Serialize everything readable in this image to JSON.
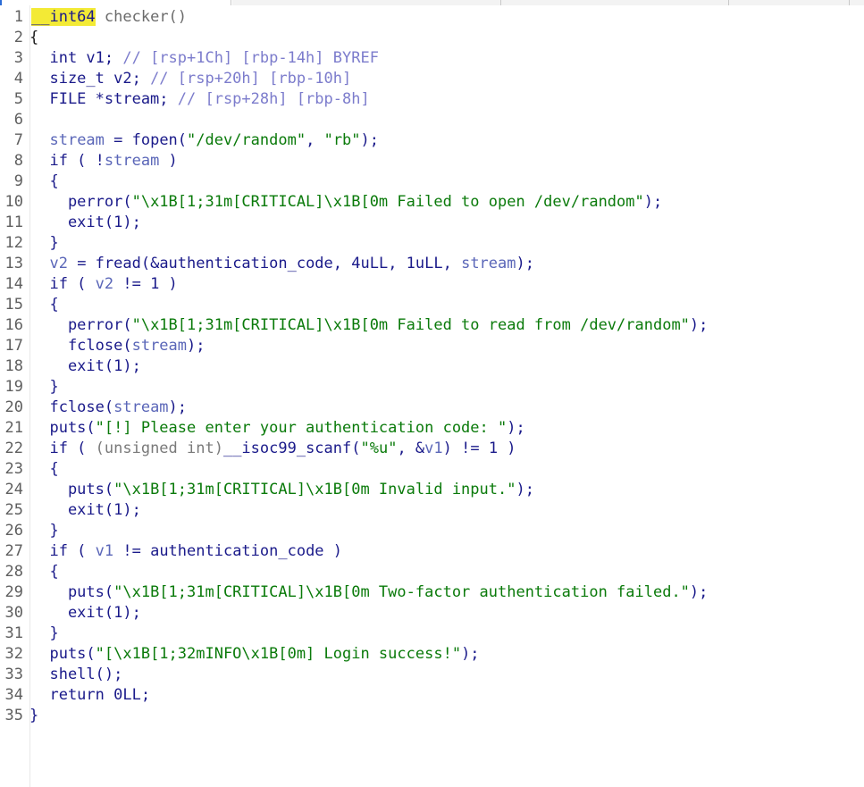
{
  "editor": {
    "lines": [
      {
        "n": "1",
        "tokens": [
          {
            "t": "__int64",
            "cls": "hl"
          },
          {
            "t": " "
          },
          {
            "t": "checker()",
            "cls": "fn"
          }
        ]
      },
      {
        "n": "2",
        "tokens": [
          {
            "t": "{",
            "x": -1
          }
        ]
      },
      {
        "n": "3",
        "tokens": [
          {
            "t": "  int v1; ",
            "cls": "k"
          },
          {
            "t": "// [rsp+1Ch] [rbp-14h] BYREF",
            "cls": "c"
          }
        ]
      },
      {
        "n": "4",
        "tokens": [
          {
            "t": "  size_t v2; ",
            "cls": "k"
          },
          {
            "t": "// [rsp+20h] [rbp-10h]",
            "cls": "c"
          }
        ]
      },
      {
        "n": "5",
        "tokens": [
          {
            "t": "  FILE *stream; ",
            "cls": "k"
          },
          {
            "t": "// [rsp+28h] [rbp-8h]",
            "cls": "c"
          }
        ]
      },
      {
        "n": "6",
        "tokens": []
      },
      {
        "n": "7",
        "tokens": [
          {
            "t": "  "
          },
          {
            "t": "stream",
            "cls": "v"
          },
          {
            "t": " = fopen(",
            "cls": "k"
          },
          {
            "t": "\"/dev/random\"",
            "cls": "s"
          },
          {
            "t": ", ",
            "cls": "k"
          },
          {
            "t": "\"rb\"",
            "cls": "s"
          },
          {
            "t": ");",
            "cls": "k"
          }
        ]
      },
      {
        "n": "8",
        "tokens": [
          {
            "t": "  if ( !",
            "cls": "k"
          },
          {
            "t": "stream",
            "cls": "v"
          },
          {
            "t": " )",
            "cls": "k"
          }
        ]
      },
      {
        "n": "9",
        "tokens": [
          {
            "t": "  {",
            "cls": "k"
          }
        ]
      },
      {
        "n": "10",
        "tokens": [
          {
            "t": "    perror(",
            "cls": "k"
          },
          {
            "t": "\"\\x1B[1;31m[CRITICAL]\\x1B[0m Failed to open /dev/random\"",
            "cls": "s"
          },
          {
            "t": ");",
            "cls": "k"
          }
        ]
      },
      {
        "n": "11",
        "tokens": [
          {
            "t": "    exit(1);",
            "cls": "k"
          }
        ]
      },
      {
        "n": "12",
        "tokens": [
          {
            "t": "  }",
            "cls": "k"
          }
        ]
      },
      {
        "n": "13",
        "tokens": [
          {
            "t": "  "
          },
          {
            "t": "v2",
            "cls": "v"
          },
          {
            "t": " = fread(&authentication_code, 4uLL, 1uLL, ",
            "cls": "k"
          },
          {
            "t": "stream",
            "cls": "v"
          },
          {
            "t": ");",
            "cls": "k"
          }
        ]
      },
      {
        "n": "14",
        "tokens": [
          {
            "t": "  if ( ",
            "cls": "k"
          },
          {
            "t": "v2",
            "cls": "v"
          },
          {
            "t": " != 1 )",
            "cls": "k"
          }
        ]
      },
      {
        "n": "15",
        "tokens": [
          {
            "t": "  {",
            "cls": "k"
          }
        ]
      },
      {
        "n": "16",
        "tokens": [
          {
            "t": "    perror(",
            "cls": "k"
          },
          {
            "t": "\"\\x1B[1;31m[CRITICAL]\\x1B[0m Failed to read from /dev/random\"",
            "cls": "s"
          },
          {
            "t": ");",
            "cls": "k"
          }
        ]
      },
      {
        "n": "17",
        "tokens": [
          {
            "t": "    fclose(",
            "cls": "k"
          },
          {
            "t": "stream",
            "cls": "v"
          },
          {
            "t": ");",
            "cls": "k"
          }
        ]
      },
      {
        "n": "18",
        "tokens": [
          {
            "t": "    exit(1);",
            "cls": "k"
          }
        ]
      },
      {
        "n": "19",
        "tokens": [
          {
            "t": "  }",
            "cls": "k"
          }
        ]
      },
      {
        "n": "20",
        "tokens": [
          {
            "t": "  fclose(",
            "cls": "k"
          },
          {
            "t": "stream",
            "cls": "v"
          },
          {
            "t": ");",
            "cls": "k"
          }
        ]
      },
      {
        "n": "21",
        "tokens": [
          {
            "t": "  puts(",
            "cls": "k"
          },
          {
            "t": "\"[!] Please enter your authentication code: \"",
            "cls": "s"
          },
          {
            "t": ");",
            "cls": "k"
          }
        ]
      },
      {
        "n": "22",
        "tokens": [
          {
            "t": "  if ( ",
            "cls": "k"
          },
          {
            "t": "(unsigned int)",
            "cls": "g"
          },
          {
            "t": "__isoc99_scanf(",
            "cls": "k"
          },
          {
            "t": "\"%u\"",
            "cls": "s"
          },
          {
            "t": ", &",
            "cls": "k"
          },
          {
            "t": "v1",
            "cls": "v"
          },
          {
            "t": ") != 1 )",
            "cls": "k"
          }
        ]
      },
      {
        "n": "23",
        "tokens": [
          {
            "t": "  {",
            "cls": "k"
          }
        ]
      },
      {
        "n": "24",
        "tokens": [
          {
            "t": "    puts(",
            "cls": "k"
          },
          {
            "t": "\"\\x1B[1;31m[CRITICAL]\\x1B[0m Invalid input.\"",
            "cls": "s"
          },
          {
            "t": ");",
            "cls": "k"
          }
        ]
      },
      {
        "n": "25",
        "tokens": [
          {
            "t": "    exit(1);",
            "cls": "k"
          }
        ]
      },
      {
        "n": "26",
        "tokens": [
          {
            "t": "  }",
            "cls": "k"
          }
        ]
      },
      {
        "n": "27",
        "tokens": [
          {
            "t": "  if ( ",
            "cls": "k"
          },
          {
            "t": "v1",
            "cls": "v"
          },
          {
            "t": " != authentication_code )",
            "cls": "k"
          }
        ]
      },
      {
        "n": "28",
        "tokens": [
          {
            "t": "  {",
            "cls": "k"
          }
        ]
      },
      {
        "n": "29",
        "tokens": [
          {
            "t": "    puts(",
            "cls": "k"
          },
          {
            "t": "\"\\x1B[1;31m[CRITICAL]\\x1B[0m Two-factor authentication failed.\"",
            "cls": "s"
          },
          {
            "t": ");",
            "cls": "k"
          }
        ]
      },
      {
        "n": "30",
        "tokens": [
          {
            "t": "    exit(1);",
            "cls": "k"
          }
        ]
      },
      {
        "n": "31",
        "tokens": [
          {
            "t": "  }",
            "cls": "k"
          }
        ]
      },
      {
        "n": "32",
        "tokens": [
          {
            "t": "  puts(",
            "cls": "k"
          },
          {
            "t": "\"[\\x1B[1;32mINFO\\x1B[0m] Login success!\"",
            "cls": "s"
          },
          {
            "t": ");",
            "cls": "k"
          }
        ]
      },
      {
        "n": "33",
        "tokens": [
          {
            "t": "  shell();",
            "cls": "k"
          }
        ]
      },
      {
        "n": "34",
        "tokens": [
          {
            "t": "  return 0LL;",
            "cls": "k"
          }
        ]
      },
      {
        "n": "35",
        "tokens": [
          {
            "t": "}",
            "cls": "k",
            "x": -1
          }
        ]
      }
    ]
  }
}
